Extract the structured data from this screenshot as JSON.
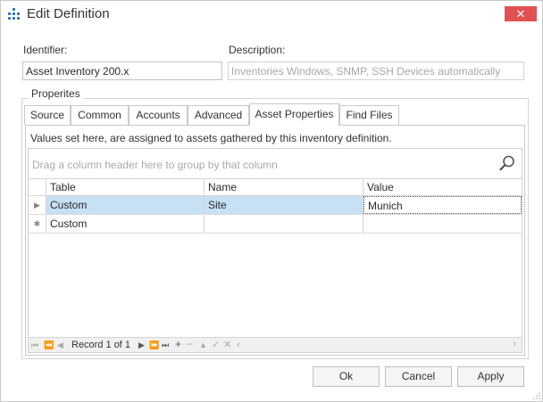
{
  "window": {
    "title": "Edit Definition",
    "close_glyph": "✕"
  },
  "identifier": {
    "label": "Identifier:",
    "value": "Asset Inventory 200.x"
  },
  "description": {
    "label": "Description:",
    "value": "Inventories Windows, SNMP, SSH Devices automatically"
  },
  "group_caption": "Properites",
  "tabs": [
    {
      "label": "Source"
    },
    {
      "label": "Common"
    },
    {
      "label": "Accounts"
    },
    {
      "label": "Advanced"
    },
    {
      "label": "Asset Properties",
      "active": true
    },
    {
      "label": "Find Files"
    }
  ],
  "panel": {
    "info": "Values set here, are assigned to assets gathered by this inventory definition.",
    "group_hint": "Drag a column header here to group by that column"
  },
  "grid": {
    "columns": [
      "Table",
      "Name",
      "Value"
    ],
    "rows": [
      {
        "indicator": "▶",
        "table": "Custom",
        "name": "Site",
        "value": "Munich"
      },
      {
        "indicator": "✱",
        "table": "Custom",
        "name": "",
        "value": ""
      }
    ]
  },
  "navigator": {
    "record_text": "Record 1 of 1"
  },
  "buttons": {
    "ok": "Ok",
    "cancel": "Cancel",
    "apply": "Apply"
  }
}
